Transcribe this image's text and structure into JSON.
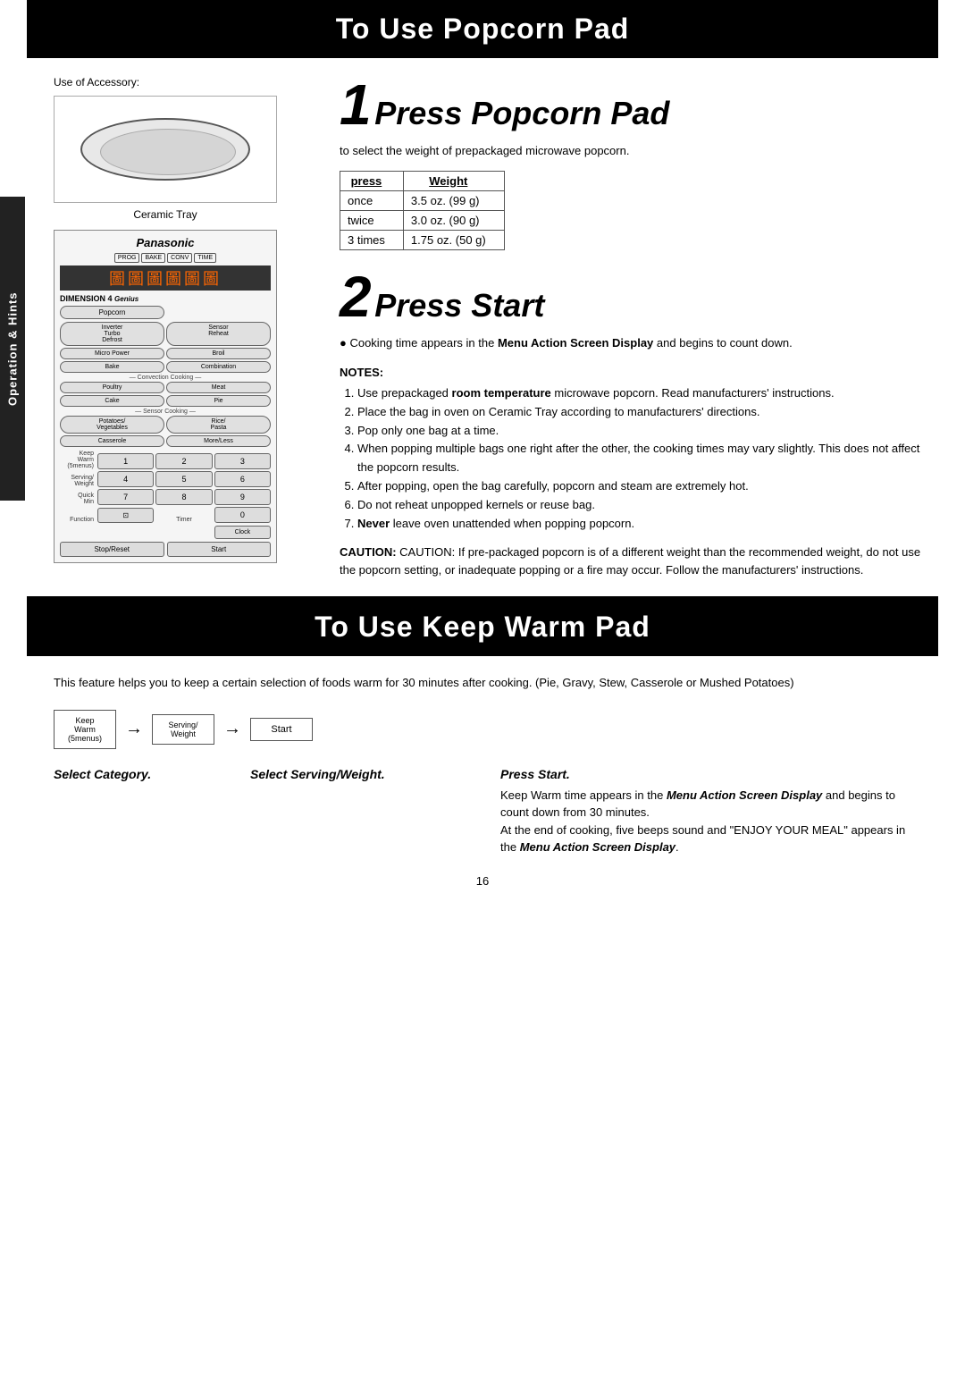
{
  "page": {
    "page_number": "16"
  },
  "side_tab": {
    "label": "Operation & Hints"
  },
  "popcorn_section": {
    "header": "To Use Popcorn Pad",
    "accessory_label": "Use of Accessory:",
    "ceramic_tray_caption": "Ceramic Tray",
    "microwave": {
      "brand": "Panasonic",
      "display_chars": "圖圖圖圖圖圖",
      "dimension_label": "DIMENSION 4",
      "buttons": [
        {
          "label": "Popcorn",
          "wide": false
        },
        {
          "label": "Inverter Turbo Defrost",
          "wide": false
        },
        {
          "label": "Sensor Reheat",
          "wide": false
        },
        {
          "label": "Micro Power",
          "wide": false
        },
        {
          "label": "Broil",
          "wide": false
        },
        {
          "label": "Bake",
          "wide": false
        },
        {
          "label": "Combination",
          "wide": false
        }
      ],
      "conv_cooking_label": "Convection Cooking",
      "conv_buttons": [
        {
          "label": "Poultry"
        },
        {
          "label": "Meat"
        },
        {
          "label": "Cake"
        },
        {
          "label": "Pie"
        }
      ],
      "sensor_label": "Sensor Cooking",
      "sensor_buttons": [
        {
          "label": "Potatoes/ Vegetables"
        },
        {
          "label": "Rice/ Pasta"
        },
        {
          "label": "Casserole"
        },
        {
          "label": "More/Less"
        }
      ],
      "numpad": [
        {
          "top": "Keep Warm (5menus)",
          "num": "1"
        },
        {
          "top": "",
          "num": "2"
        },
        {
          "top": "",
          "num": "3"
        },
        {
          "top": "Serving/ Weight",
          "num": "4"
        },
        {
          "top": "",
          "num": "5"
        },
        {
          "top": "",
          "num": "6"
        },
        {
          "top": "Quick Min",
          "num": "7"
        },
        {
          "top": "",
          "num": "8"
        },
        {
          "top": "",
          "num": "9"
        },
        {
          "top": "Function",
          "num": "⊡"
        },
        {
          "top": "Timer",
          "num": "0"
        },
        {
          "top": "",
          "num": "Clock"
        }
      ],
      "bottom_buttons": [
        {
          "label": "Stop/Reset"
        },
        {
          "label": "Start"
        }
      ]
    },
    "step1": {
      "number": "1",
      "title": "Press Popcorn Pad",
      "description": "to select the weight of prepackaged microwave popcorn.",
      "table": {
        "headers": [
          "press",
          "Weight"
        ],
        "rows": [
          {
            "press": "once",
            "weight": "3.5 oz. (99 g)"
          },
          {
            "press": "twice",
            "weight": "3.0 oz. (90 g)"
          },
          {
            "press": "3 times",
            "weight": "1.75 oz. (50 g)"
          }
        ]
      }
    },
    "step2": {
      "number": "2",
      "title": "Press Start",
      "description": "● Cooking time appears in the Menu Action Screen Display and begins to count down.",
      "notes_title": "NOTES:",
      "notes": [
        "Use prepackaged room temperature microwave popcorn. Read manufacturers' instructions.",
        "Place the bag in oven on Ceramic Tray according to manufacturers' directions.",
        "Pop only one bag at a time.",
        "When popping multiple bags one right after the other, the cooking times may vary slightly. This does not affect the popcorn results.",
        "After popping, open the bag carefully, popcorn and steam are extremely hot.",
        "Do not reheat unpopped kernels or reuse bag.",
        "Never leave oven unattended when popping popcorn."
      ],
      "caution": "CAUTION: If pre-packaged popcorn is of a different weight than the recommended weight, do not use the popcorn setting, or inadequate popping or a fire may occur. Follow the manufacturers' instructions."
    }
  },
  "keep_warm_section": {
    "header": "To Use Keep Warm Pad",
    "description": "This feature helps you to keep a certain selection of foods warm for 30 minutes after cooking. (Pie, Gravy, Stew, Casserole or Mushed Potatoes)",
    "steps": [
      {
        "id": "step1",
        "button_label": "Keep\nWarm\n(5menus)",
        "step_title": "Select Category.",
        "step_desc": ""
      },
      {
        "id": "step2",
        "button_label": "Serving/\nWeight",
        "step_title": "Select Serving/Weight.",
        "step_desc": ""
      },
      {
        "id": "step3",
        "button_label": "Start",
        "step_title": "Press Start.",
        "step_desc": "Keep Warm time appears in the Menu Action Screen Display and begins to count down from 30 minutes.\nAt the end of cooking, five beeps sound and \"ENJOY YOUR MEAL\" appears in the Menu Action Screen Display."
      }
    ]
  }
}
